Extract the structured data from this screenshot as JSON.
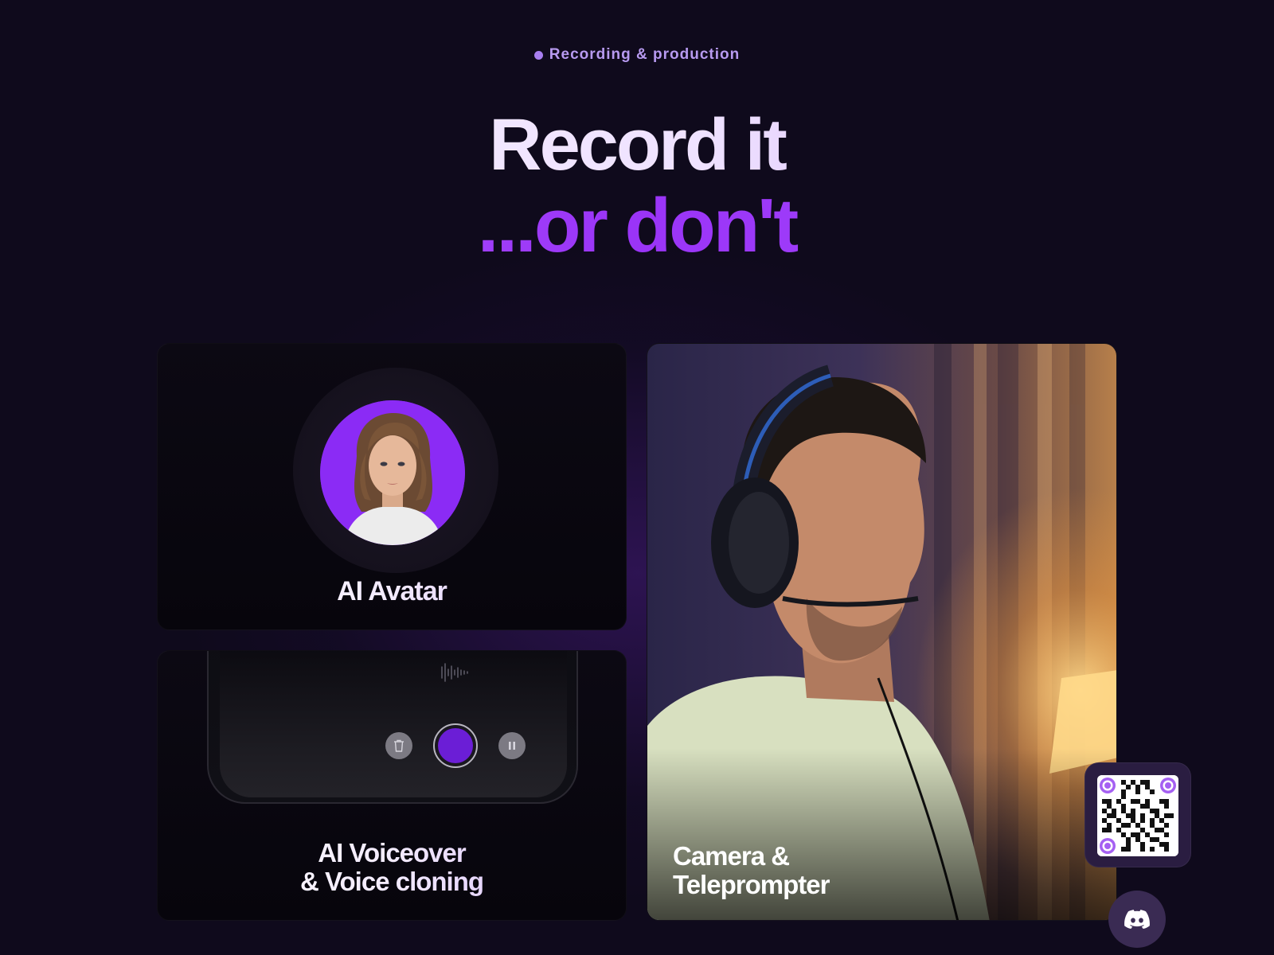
{
  "section": {
    "eyebrow": "Recording & production",
    "headline_line1": "Record it",
    "headline_line2": "...or don't"
  },
  "cards": {
    "avatar": {
      "title": "AI Avatar"
    },
    "voice": {
      "title_line1": "AI Voiceover",
      "title_line2": "& Voice cloning"
    },
    "camera": {
      "title_line1": "Camera &",
      "title_line2": "Teleprompter"
    }
  },
  "icons": {
    "eyebrow": "dot-icon",
    "waveform": "waveform-icon",
    "trash": "trash-icon",
    "record": "record-icon",
    "pause": "pause-icon",
    "qr": "qr-code",
    "discord": "discord-icon"
  },
  "colors": {
    "background": "#0f0a1c",
    "accent_purple": "#9a34f7",
    "eyebrow": "#b79af0",
    "record_button": "#6b1ed6"
  }
}
